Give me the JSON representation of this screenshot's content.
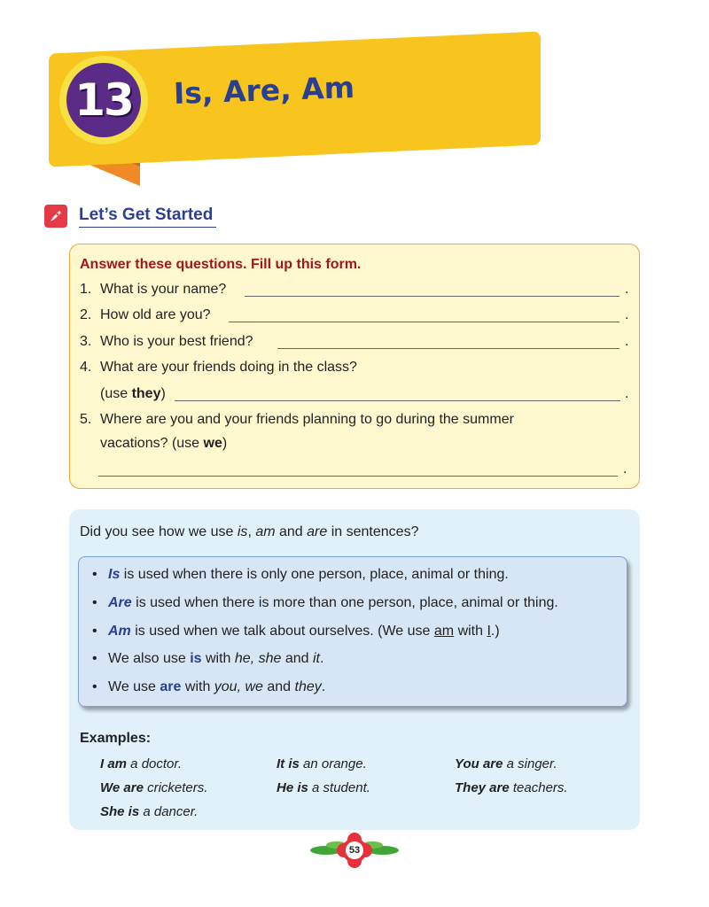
{
  "chapter": {
    "number": "13",
    "title": "Is, Are, Am"
  },
  "section_title": "Let’s Get Started",
  "form": {
    "instruction": "Answer these questions. Fill up this form.",
    "questions": [
      {
        "num": "1.",
        "text": "What is your name?"
      },
      {
        "num": "2.",
        "text": "How old are you?"
      },
      {
        "num": "3.",
        "text": "Who is your best friend?"
      },
      {
        "num": "4.",
        "text": "What are your friends doing in the class?"
      },
      {
        "num": "5.",
        "text": "Where are you and your friends planning to go during the summer"
      }
    ],
    "q4_hint_pre": "(use ",
    "q4_hint_word": "they",
    "q4_hint_post": ")",
    "q5_line2_pre": "vacations? (use ",
    "q5_line2_word": "we",
    "q5_line2_post": ")",
    "end_mark": "."
  },
  "info": {
    "intro_pre": "Did you see how we use ",
    "intro_is": "is",
    "intro_sep1": ", ",
    "intro_am": "am",
    "intro_sep2": " and ",
    "intro_are": "are",
    "intro_post": " in sentences?",
    "bullet": "•",
    "rules": {
      "r1_kw": "Is",
      "r1_text": " is used when there is only one person, place, animal or thing.",
      "r2_kw": "Are",
      "r2_text": " is used when there is more than one person, place, animal or thing.",
      "r3_kw": "Am",
      "r3_text": " is used when we talk about ourselves. (We use ",
      "r3_am": "am",
      "r3_with": " with ",
      "r3_i": "I",
      "r3_end": ".)",
      "r4_pre": "We also use ",
      "r4_kw": "is",
      "r4_mid": " with ",
      "r4_it1": "he, she",
      "r4_and": " and ",
      "r4_it2": "it",
      "r4_end": ".",
      "r5_pre": "We use ",
      "r5_kw": "are",
      "r5_mid": " with ",
      "r5_it1": "you, we",
      "r5_and": " and ",
      "r5_it2": "they",
      "r5_end": "."
    },
    "examples_title": "Examples:",
    "examples": [
      {
        "bold": "I am",
        "rest": " a doctor."
      },
      {
        "bold": "It is",
        "rest": " an orange."
      },
      {
        "bold": "You are",
        "rest": " a singer."
      },
      {
        "bold": "We are",
        "rest": " cricketers."
      },
      {
        "bold": "He is",
        "rest": " a student."
      },
      {
        "bold": "They are",
        "rest": " teachers."
      },
      {
        "bold": "She is",
        "rest": " a dancer."
      }
    ]
  },
  "page_number": "53",
  "colors": {
    "banner": "#f7c51e",
    "badge": "#5a2b87",
    "title": "#2a3f8f",
    "instruction": "#a4161a"
  },
  "icons": {
    "section": "rocket-icon"
  }
}
